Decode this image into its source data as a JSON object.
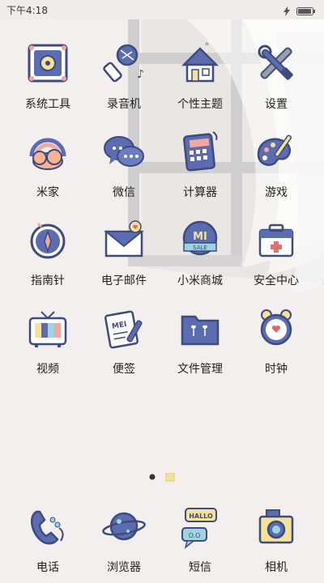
{
  "status_bar": {
    "time": "下午4:18"
  },
  "apps": [
    {
      "label": "系统工具",
      "icon": "tools-frame-icon"
    },
    {
      "label": "录音机",
      "icon": "microphone-icon"
    },
    {
      "label": "个性主题",
      "icon": "house-theme-icon"
    },
    {
      "label": "设置",
      "icon": "wrench-screwdriver-icon"
    },
    {
      "label": "米家",
      "icon": "rainbow-cloud-icon"
    },
    {
      "label": "微信",
      "icon": "chat-bubbles-icon"
    },
    {
      "label": "计算器",
      "icon": "calculator-icon"
    },
    {
      "label": "游戏",
      "icon": "palette-brush-icon"
    },
    {
      "label": "指南针",
      "icon": "compass-icon"
    },
    {
      "label": "电子邮件",
      "icon": "envelope-heart-icon"
    },
    {
      "label": "小米商城",
      "icon": "mi-sale-badge-icon"
    },
    {
      "label": "安全中心",
      "icon": "first-aid-box-icon"
    },
    {
      "label": "视频",
      "icon": "tv-icon"
    },
    {
      "label": "便签",
      "icon": "notepad-pencil-icon"
    },
    {
      "label": "文件管理",
      "icon": "folder-icon"
    },
    {
      "label": "时钟",
      "icon": "alarm-clock-icon"
    }
  ],
  "dock": [
    {
      "label": "电话",
      "icon": "telephone-icon"
    },
    {
      "label": "浏览器",
      "icon": "planet-browser-icon"
    },
    {
      "label": "短信",
      "icon": "hello-bubble-icon"
    },
    {
      "label": "相机",
      "icon": "camera-icon"
    }
  ],
  "icon_text": {
    "mail_badge_text": "MEI",
    "store_badge_top": "MI",
    "store_badge_bottom": "SALE",
    "sms_bubble_top": "HALLO",
    "sms_bubble_bottom": "O.O"
  },
  "page_indicator": {
    "count": 2,
    "active": 0
  },
  "colors": {
    "navy": "#3f4a7d",
    "blue": "#5b6cb0",
    "pink": "#f2a8a0",
    "yellow": "#f4e29a",
    "bg": "#f3efee"
  }
}
